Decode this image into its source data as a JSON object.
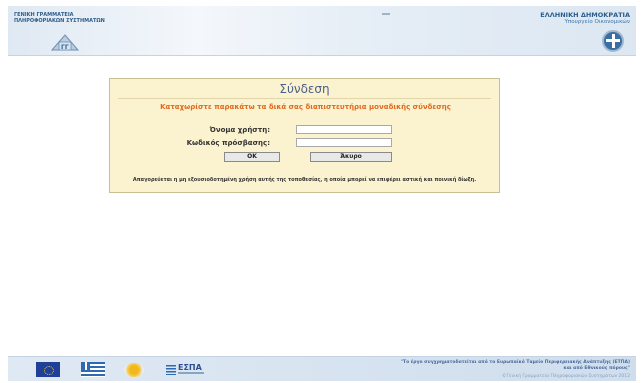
{
  "header": {
    "org_left_line1": "ΓΕΝΙΚΗ ΓΡΑΜΜΑΤΕΙΑ",
    "org_left_line2": "ΠΛΗΡΟΦΟΡΙΑΚΩΝ ΣΥΣΤΗΜΑΤΩΝ",
    "org_right_line1": "ΕΛΛΗΝΙΚΗ ΔΗΜΟΚΡΑΤΙΑ",
    "org_right_line2": "Υπουργείο Οικονομικών",
    "logo_icon": "gsis-logo",
    "emblem_icon": "greek-emblem-icon"
  },
  "login": {
    "title": "Σύνδεση",
    "prompt": "Καταχωρίστε παρακάτω τα δικά σας διαπιστευτήρια μοναδικής σύνδεσης",
    "username_label": "Όνομα χρήστη:",
    "username_value": "",
    "password_label": "Κωδικός πρόσβασης:",
    "password_value": "",
    "ok_label": "OK",
    "cancel_label": "Άκυρο",
    "warning": "Απαγορεύεται η μη εξουσιοδοτημένη χρήση αυτής της τοποθεσίας, η οποία μπορεί να επιφέρει αστική και ποινική δίωξη."
  },
  "footer": {
    "text_line1": "\"Το έργο συγχρηματοδοτείται από το Ευρωπαϊκό Ταμείο Περιφερειακής Ανάπτυξης (ΕΤΠΑ)",
    "text_line2": "και από Εθνικούς πόρους\"",
    "copyright": "©Γενική Γραμματεία Πληροφοριακών Συστημάτων 2012",
    "espa_label": "ΕΣΠΑ",
    "logos": [
      "eu-flag-icon",
      "greek-flag-icon",
      "program-logo-icon",
      "espa-logo-icon"
    ]
  },
  "colors": {
    "panel_bg": "#fbf2cf",
    "prompt": "#e06a1d",
    "title": "#4a5e86",
    "header_bg": "#dfe9f3"
  }
}
